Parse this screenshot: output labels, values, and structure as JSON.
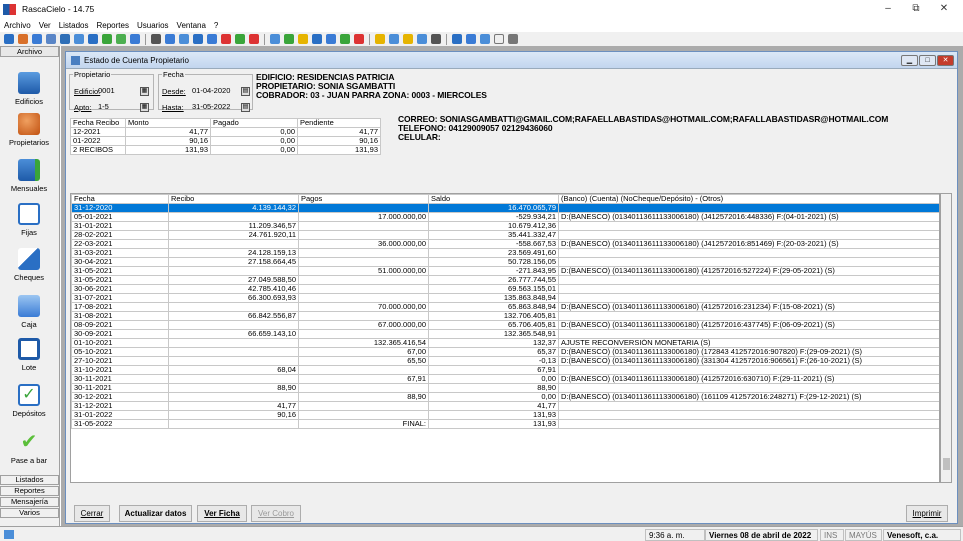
{
  "app": {
    "title": "RascaCielo - 14.75"
  },
  "window_controls": {
    "minimize": "–",
    "restore": "⧉",
    "close": "✕"
  },
  "menu": [
    "Archivo",
    "Ver",
    "Listados",
    "Reportes",
    "Usuarios",
    "Ventana",
    "?"
  ],
  "sidebar": {
    "header": "Archivo",
    "items": [
      {
        "label": "Edificios",
        "icon": "buildings-icon"
      },
      {
        "label": "Propietarios",
        "icon": "owners-icon"
      },
      {
        "label": "Mensuales",
        "icon": "monthly-icon"
      },
      {
        "label": "Fijas",
        "icon": "document-icon"
      },
      {
        "label": "Cheques",
        "icon": "edit-icon"
      },
      {
        "label": "Caja",
        "icon": "monitor-icon"
      },
      {
        "label": "Lote",
        "icon": "windows-icon"
      },
      {
        "label": "Depósitos",
        "icon": "checkbox-icon"
      },
      {
        "label": "Pase a bar",
        "icon": "checkmark-icon"
      }
    ],
    "footer": [
      "Listados",
      "Reportes",
      "Mensajería",
      "Varios"
    ]
  },
  "child": {
    "title": "Estado de Cuenta Propietario",
    "propietario": {
      "legend": "Propietario",
      "edificio_label": "Edificio:",
      "edificio_value": "0001",
      "apto_label": "Apto:",
      "apto_value": "1-5"
    },
    "fecha": {
      "legend": "Fecha",
      "desde_label": "Desde:",
      "desde_value": "01-04-2020",
      "hasta_label": "Hasta:",
      "hasta_value": "31-05-2022"
    },
    "info": {
      "edificio": "EDIFICIO: RESIDENCIAS PATRICIA",
      "propietario": "PROPIETARIO: SONIA SGAMBATTI",
      "cobrador": "COBRADOR: 03 - JUAN PARRA   ZONA: 0003 - MIERCOLES",
      "correo": "CORREO: SONIASGAMBATTI@GMAIL.COM;RAFAELLABASTIDAS@HOTMAIL.COM;RAFALLABASTIDASR@HOTMAIL.COM",
      "telefono": "TELEFONO: 04129009057 02129436060",
      "celular": "CELULAR:"
    },
    "summary": {
      "headers": [
        "Fecha Recibo",
        "Monto",
        "Pagado",
        "Pendiente"
      ],
      "rows": [
        [
          "12-2021",
          "41,77",
          "0,00",
          "41,77"
        ],
        [
          "01-2022",
          "90,16",
          "0,00",
          "90,16"
        ],
        [
          "2 RECIBOS",
          "131,93",
          "0,00",
          "131,93"
        ]
      ]
    },
    "table": {
      "headers": [
        "Fecha",
        "Recibo",
        "Pagos",
        "Saldo",
        "(Banco) (Cuenta) (NoCheque/Depósito) - (Otros)"
      ],
      "rows": [
        [
          "31-12-2020",
          "4.139.144,32",
          "",
          "16.470.065,79",
          ""
        ],
        [
          "05-01-2021",
          "",
          "17.000.000,00",
          "-529.934,21",
          "D:(BANESCO) (01340113611133006180) (J412572016:448336) F:(04-01-2021) (S)"
        ],
        [
          "31-01-2021",
          "11.209.346,57",
          "",
          "10.679.412,36",
          ""
        ],
        [
          "28-02-2021",
          "24.761.920,11",
          "",
          "35.441.332,47",
          ""
        ],
        [
          "22-03-2021",
          "",
          "36.000.000,00",
          "-558.667,53",
          "D:(BANESCO) (01340113611133006180) (J412572016:851469) F:(20-03-2021) (S)"
        ],
        [
          "31-03-2021",
          "24.128.159,13",
          "",
          "23.569.491,60",
          ""
        ],
        [
          "30-04-2021",
          "27.158.664,45",
          "",
          "50.728.156,05",
          ""
        ],
        [
          "31-05-2021",
          "",
          "51.000.000,00",
          "-271.843,95",
          "D:(BANESCO) (01340113611133006180) (412572016:527224) F:(29-05-2021) (S)"
        ],
        [
          "31-05-2021",
          "27.049.588,50",
          "",
          "26.777.744,55",
          ""
        ],
        [
          "30-06-2021",
          "42.785.410,46",
          "",
          "69.563.155,01",
          ""
        ],
        [
          "31-07-2021",
          "66.300.693,93",
          "",
          "135.863.848,94",
          ""
        ],
        [
          "17-08-2021",
          "",
          "70.000.000,00",
          "65.863.848,94",
          "D:(BANESCO) (01340113611133006180) (412572016:231234) F:(15-08-2021) (S)"
        ],
        [
          "31-08-2021",
          "66.842.556,87",
          "",
          "132.706.405,81",
          ""
        ],
        [
          "08-09-2021",
          "",
          "67.000.000,00",
          "65.706.405,81",
          "D:(BANESCO) (01340113611133006180) (412572016:437745) F:(06-09-2021) (S)"
        ],
        [
          "30-09-2021",
          "66.659.143,10",
          "",
          "132.365.548,91",
          ""
        ],
        [
          "01-10-2021",
          "",
          "132.365.416,54",
          "132,37",
          "AJUSTE RECONVERSIÓN MONETARIA (S)"
        ],
        [
          "05-10-2021",
          "",
          "67,00",
          "65,37",
          "D:(BANESCO) (01340113611133006180) (172843  412572016:907820) F:(29-09-2021) (S)"
        ],
        [
          "27-10-2021",
          "",
          "65,50",
          "-0,13",
          "D:(BANESCO) (01340113611133006180) (331304  412572016:906561) F:(26-10-2021) (S)"
        ],
        [
          "31-10-2021",
          "68,04",
          "",
          "67,91",
          ""
        ],
        [
          "30-11-2021",
          "",
          "67,91",
          "0,00",
          "D:(BANESCO) (01340113611133006180) (412572016:630710) F:(29-11-2021) (S)"
        ],
        [
          "30-11-2021",
          "88,90",
          "",
          "88,90",
          ""
        ],
        [
          "30-12-2021",
          "",
          "88,90",
          "0,00",
          "D:(BANESCO) (01340113611133006180) (161109  412572016:248271) F:(29-12-2021) (S)"
        ],
        [
          "31-12-2021",
          "41,77",
          "",
          "41,77",
          ""
        ],
        [
          "31-01-2022",
          "90,16",
          "",
          "131,93",
          ""
        ],
        [
          "31-05-2022",
          "",
          "FINAL:",
          "131,93",
          ""
        ]
      ]
    },
    "buttons": {
      "cerrar": "Cerrar",
      "actualizar": "Actualizar datos",
      "ver_ficha": "Ver Ficha",
      "ver_cobro": "Ver Cobro",
      "imprimir": "Imprimir"
    }
  },
  "status": {
    "time": "9:36 a. m.",
    "date": "Viernes 08 de abril de 2022",
    "ins": "INS",
    "mayus": "MAYÚS",
    "company": "Venesoft, c.a."
  },
  "colors": {
    "accent": "#1e5aa8",
    "selected_row": "#0078d7"
  }
}
